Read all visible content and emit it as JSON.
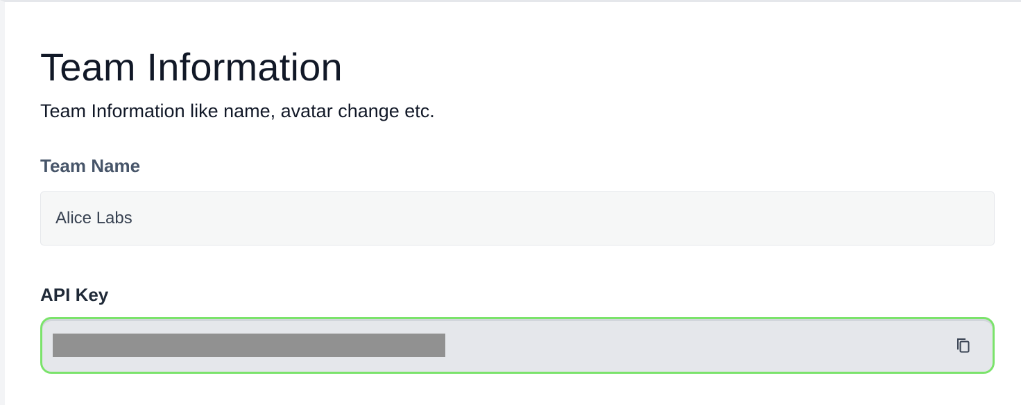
{
  "header": {
    "title": "Team Information",
    "subtitle": "Team Information like name, avatar change etc."
  },
  "team_name": {
    "label": "Team Name",
    "value": "Alice Labs"
  },
  "api_key": {
    "label": "API Key",
    "value_state": "masked",
    "copy_icon": "copy-icon"
  },
  "colors": {
    "focus_ring": "#7be36b",
    "title_text": "#111827",
    "label_muted": "#475569",
    "mask": "#919191"
  }
}
